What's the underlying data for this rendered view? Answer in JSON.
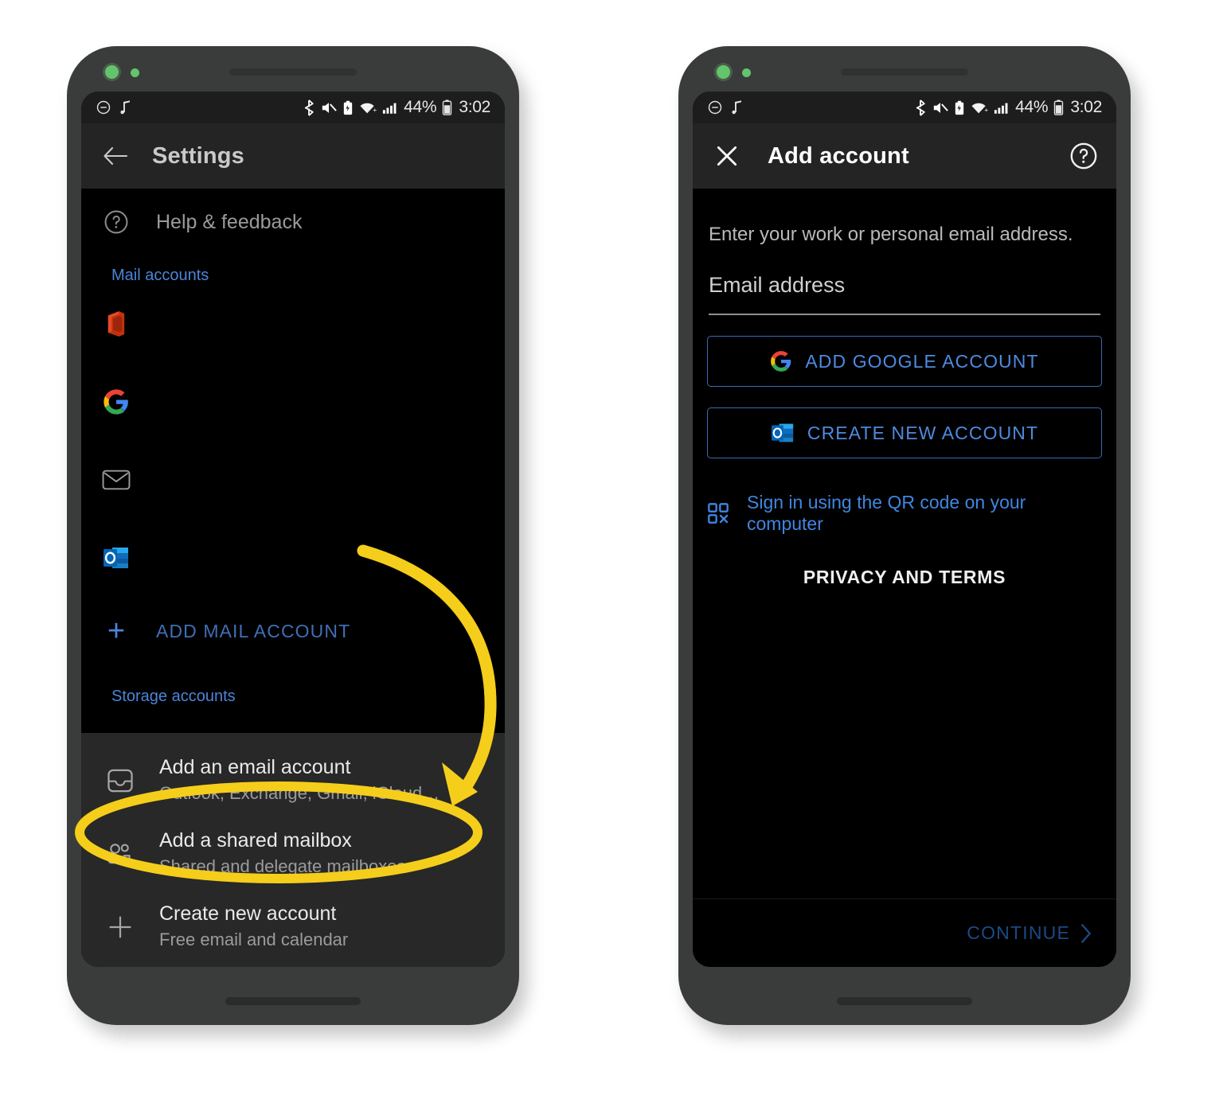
{
  "status_bar": {
    "left_icons": [
      "dnd-icon",
      "music-note-icon"
    ],
    "right_icons": [
      "bluetooth-icon",
      "volume-muted-icon",
      "battery-saver-icon",
      "wifi-icon",
      "cellular-signal-icon"
    ],
    "battery_percent": "44%",
    "clock": "3:02"
  },
  "left_phone": {
    "appbar": {
      "back_icon": "arrow-left-icon",
      "title": "Settings"
    },
    "help_row": {
      "icon": "help-circle-icon",
      "label": "Help & feedback"
    },
    "mail_accounts_header": "Mail accounts",
    "accounts": [
      {
        "icon": "office-icon"
      },
      {
        "icon": "google-icon"
      },
      {
        "icon": "envelope-icon"
      },
      {
        "icon": "outlook-icon"
      }
    ],
    "add_mail_account": {
      "icon": "plus-icon",
      "label": "ADD MAIL ACCOUNT"
    },
    "storage_accounts_header": "Storage accounts",
    "sheet_items": [
      {
        "icon": "inbox-tray-icon",
        "title": "Add an email account",
        "subtitle": "Outlook, Exchange, Gmail, iCloud…"
      },
      {
        "icon": "people-group-icon",
        "title": "Add a shared mailbox",
        "subtitle": "Shared and delegate mailboxes"
      },
      {
        "icon": "plus-icon",
        "title": "Create new account",
        "subtitle": "Free email and calendar"
      }
    ]
  },
  "right_phone": {
    "appbar": {
      "close_icon": "close-x-icon",
      "title": "Add account",
      "help_icon": "help-circle-icon"
    },
    "hint": "Enter your work or personal email address.",
    "email_field": {
      "placeholder": "Email address",
      "value": ""
    },
    "google_button": {
      "icon": "google-icon",
      "label": "ADD GOOGLE ACCOUNT"
    },
    "create_button": {
      "icon": "outlook-icon",
      "label": "CREATE NEW ACCOUNT"
    },
    "qr_link": {
      "icon": "qr-code-icon",
      "label": "Sign in using the QR code on your computer"
    },
    "privacy": "PRIVACY AND TERMS",
    "continue_button": {
      "label": "CONTINUE",
      "chevron_icon": "chevron-right-icon"
    }
  },
  "annotations": {
    "highlight_color": "#F5CE1B",
    "ellipse_target": "Add an email account",
    "arrow": "curved-arrow-pointing-to-add-an-email-account"
  }
}
